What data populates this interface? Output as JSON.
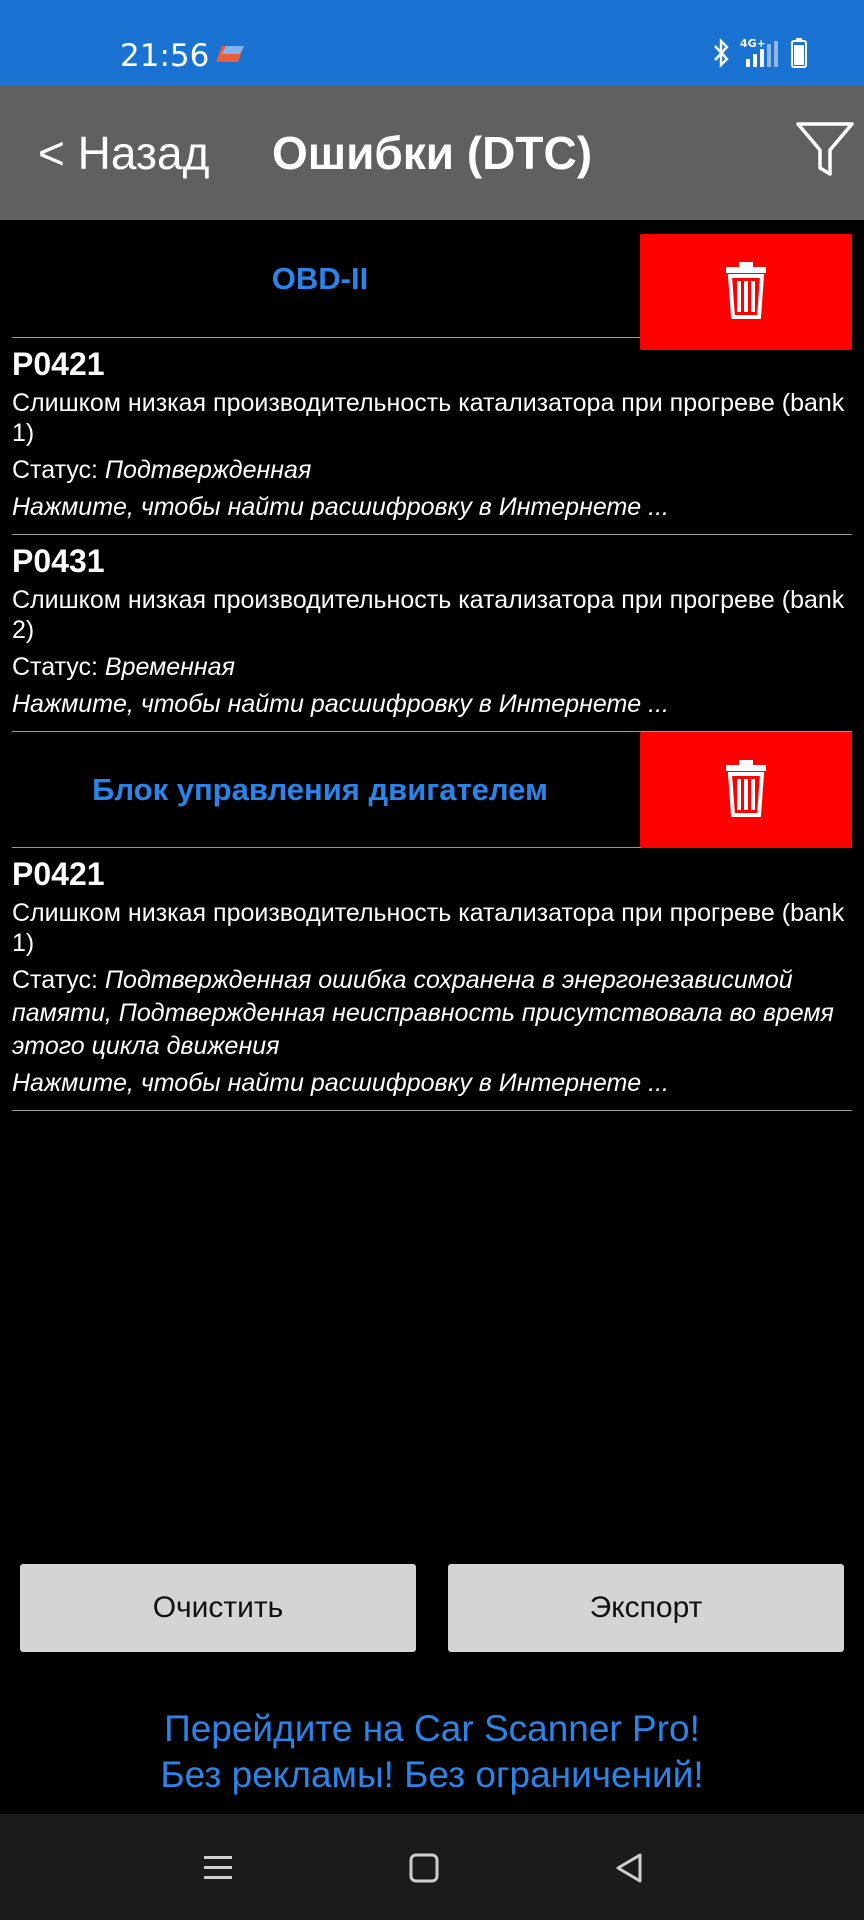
{
  "status_bar": {
    "time": "21:56",
    "network": "4G+",
    "icons": [
      "app-notification-icon",
      "bluetooth-icon",
      "signal-icon",
      "battery-icon"
    ]
  },
  "nav": {
    "back_label": "< Назад",
    "title": "Ошибки (DTC)",
    "filter_icon": "filter-icon"
  },
  "sections": [
    {
      "title": "OBD-II",
      "delete_icon": "trash-icon",
      "items": [
        {
          "code": "P0421",
          "description": "Слишком низкая производительность катализатора при прогреве (bank 1)",
          "status_label": "Статус: ",
          "status_value": "Подтвержденная",
          "link": "Нажмите, чтобы найти расшифровку в Интернете ..."
        },
        {
          "code": "P0431",
          "description": "Слишком низкая производительность катализатора при прогреве (bank 2)",
          "status_label": "Статус: ",
          "status_value": "Временная",
          "link": "Нажмите, чтобы найти расшифровку в Интернете ..."
        }
      ]
    },
    {
      "title": "Блок управления двигателем",
      "delete_icon": "trash-icon",
      "items": [
        {
          "code": "P0421",
          "description": "Слишком низкая производительность катализатора при прогреве (bank 1)",
          "status_label": "Статус: ",
          "status_value": "Подтвержденная ошибка сохранена в энергонезависимой памяти, Подтвержденная неисправность присутствовала во время этого цикла движения",
          "link": "Нажмите, чтобы найти расшифровку в Интернете ..."
        }
      ]
    }
  ],
  "buttons": {
    "clear": "Очистить",
    "export": "Экспорт"
  },
  "promo": {
    "line1": "Перейдите на Car Scanner Pro!",
    "line2": "Без рекламы! Без ограничений!"
  },
  "colors": {
    "status_bar": "#1a73d2",
    "nav_bar": "#606060",
    "accent_blue": "#2b85e8",
    "delete_red": "#ff0000",
    "button_gray": "#d4d4d4"
  }
}
